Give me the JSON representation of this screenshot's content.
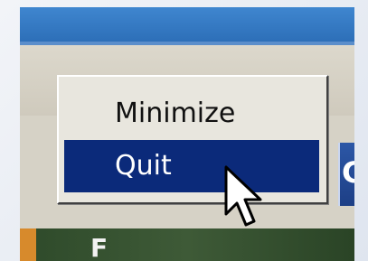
{
  "context_menu": {
    "items": [
      {
        "label": "Minimize",
        "selected": false
      },
      {
        "label": "Quit",
        "selected": true
      }
    ]
  },
  "colors": {
    "title_bar": "#3f86cf",
    "menu_background": "#e8e6de",
    "menu_highlight": "#0b2a7a",
    "menu_highlight_text": "#ffffff",
    "window_face": "#d6d2c6"
  },
  "icons": {
    "pointer": "mouse-pointer-icon"
  }
}
